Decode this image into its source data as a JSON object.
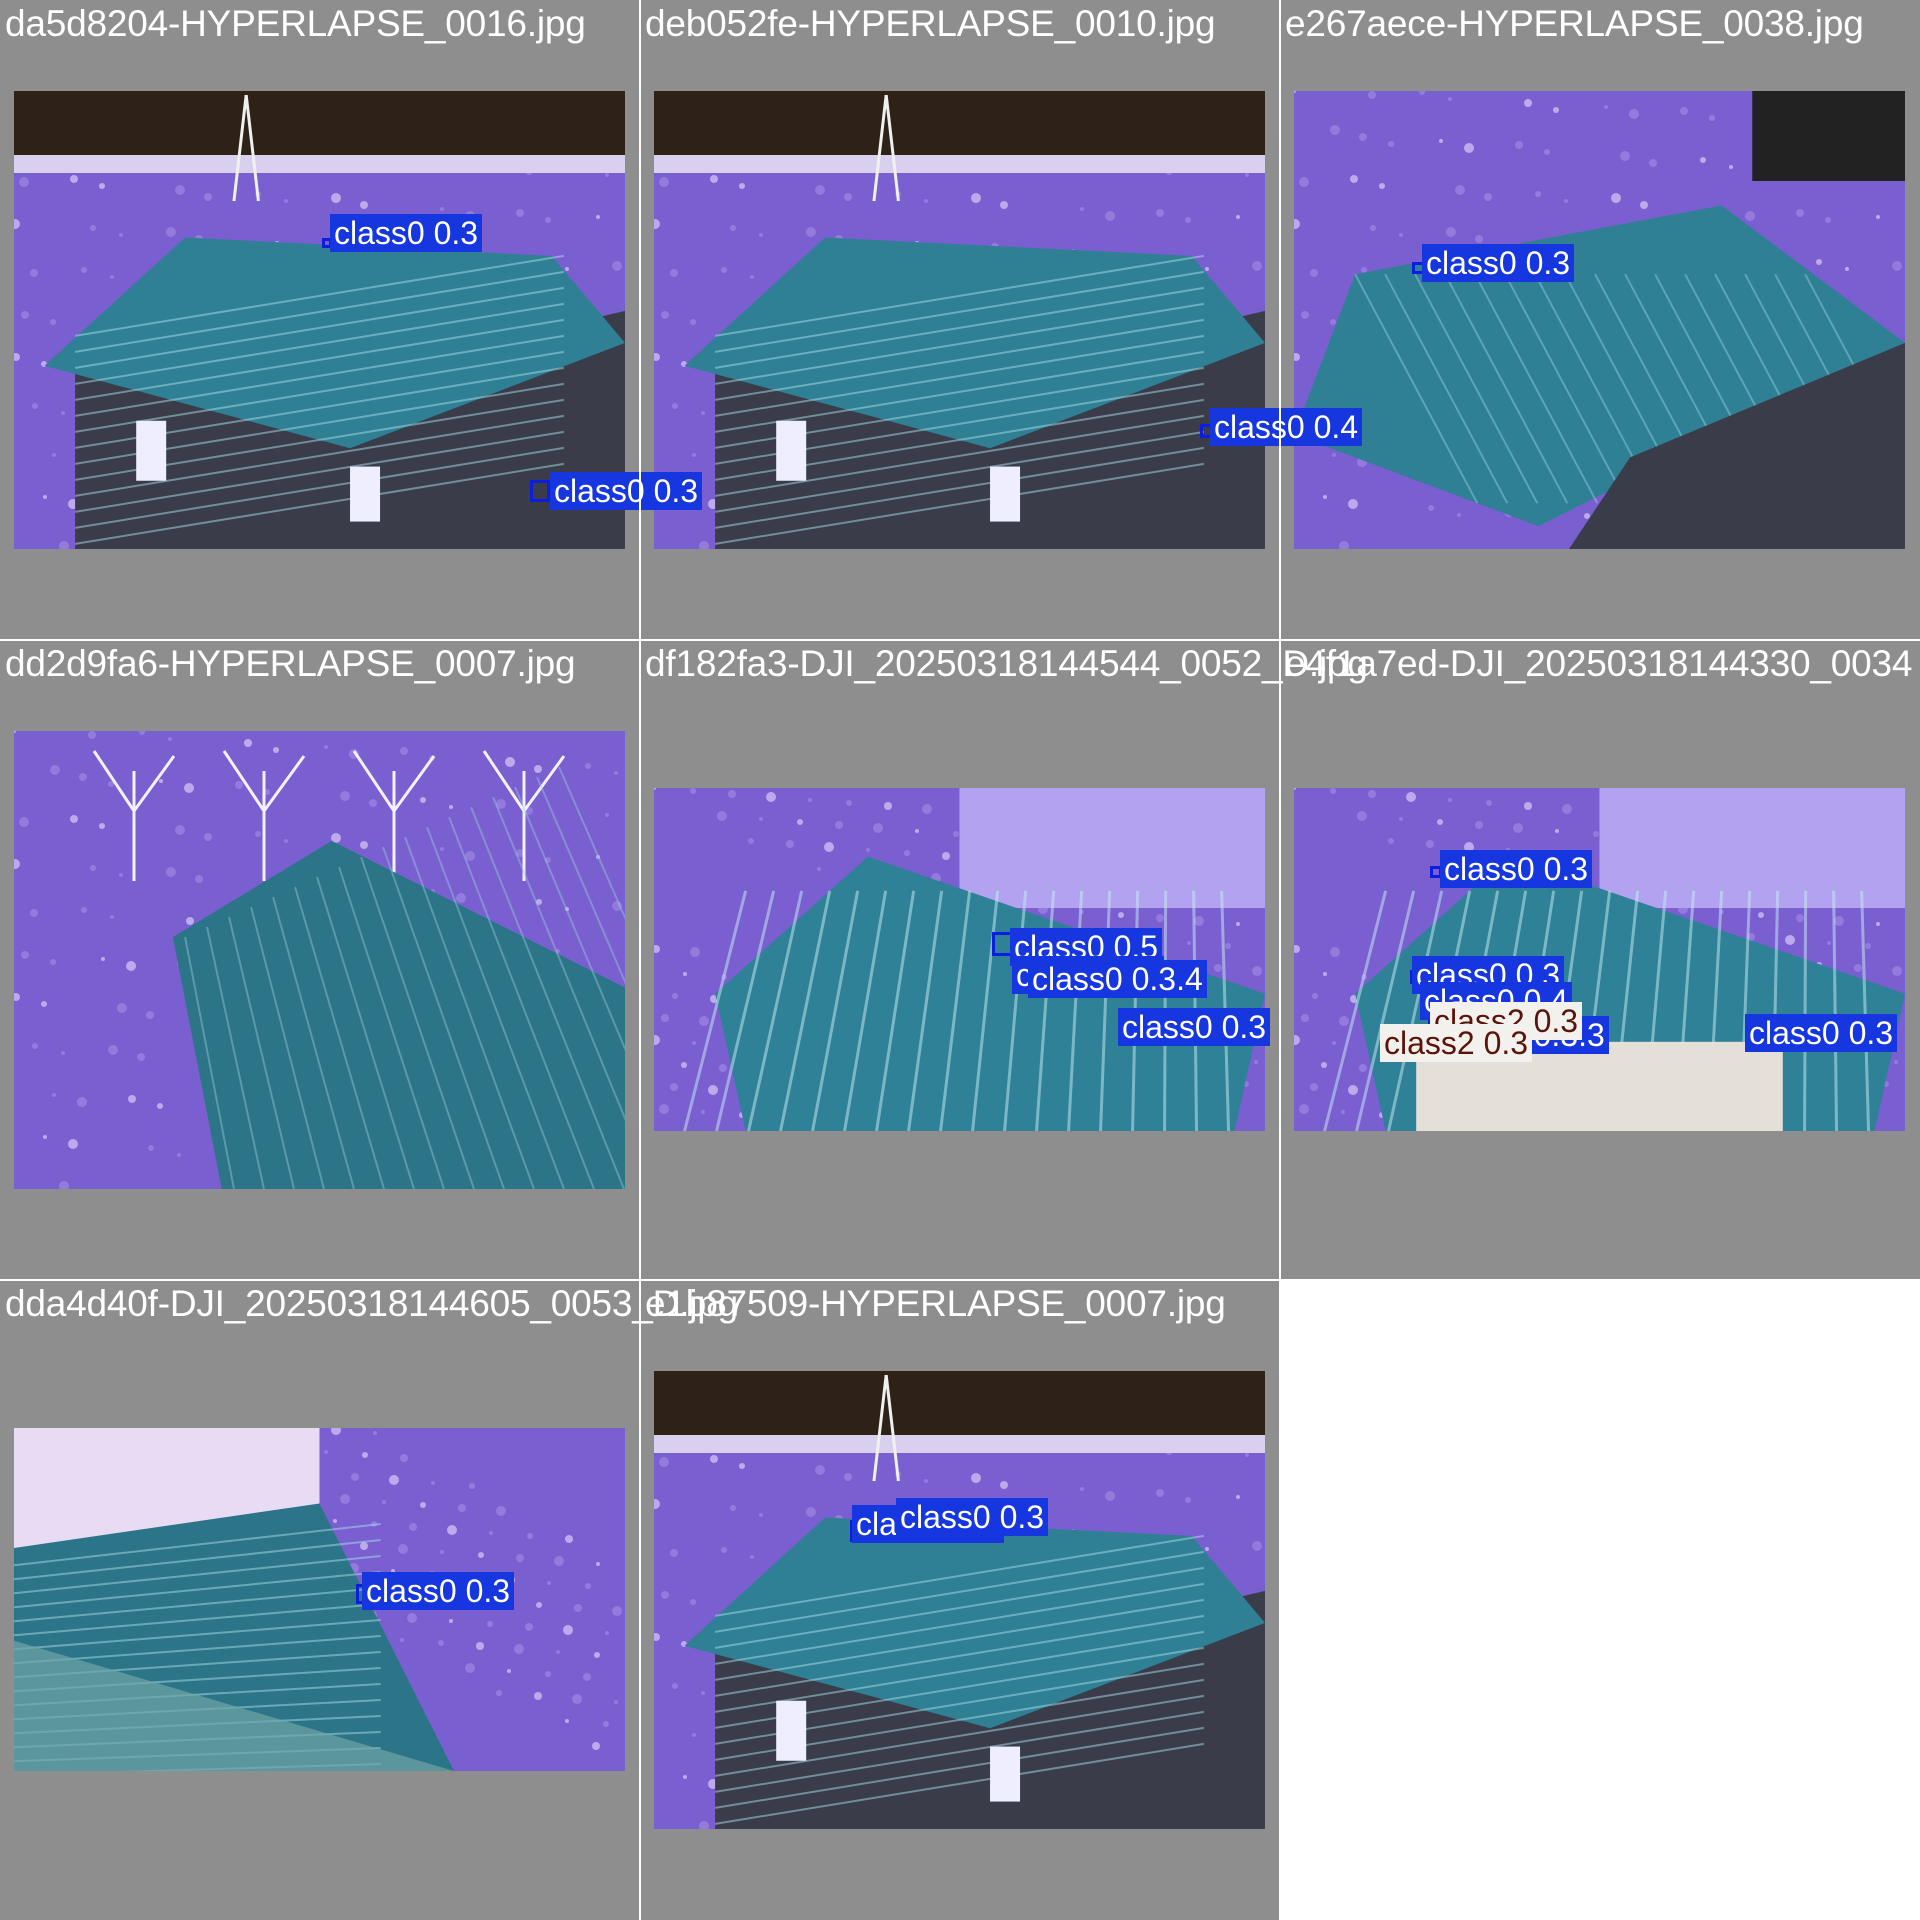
{
  "mosaic": {
    "background_color": "#8e8e8e",
    "cells": [
      {
        "title": "da5d8204-HYPERLAPSE_0016.jpg",
        "scene": "sky",
        "detections": [
          {
            "label": "class0 0.3",
            "cls": "class0"
          },
          {
            "label": "class0 0.3",
            "cls": "class0"
          }
        ]
      },
      {
        "title": "deb052fe-HYPERLAPSE_0010.jpg",
        "scene": "sky",
        "detections": [
          {
            "label": "class0 0.4",
            "cls": "class0"
          }
        ]
      },
      {
        "title": "e267aece-HYPERLAPSE_0038.jpg",
        "scene": "yard",
        "detections": [
          {
            "label": "class0 0.3",
            "cls": "class0"
          }
        ]
      },
      {
        "title": "dd2d9fa6-HYPERLAPSE_0007.jpg",
        "scene": "field",
        "detections": []
      },
      {
        "title": "df182fa3-DJI_20250318144544_0052_D.jpg",
        "scene": "closeup",
        "detections": [
          {
            "label": "class0 0.5",
            "cls": "class0"
          },
          {
            "label": "class0 0.4",
            "cls": "class0"
          },
          {
            "label": "class0 0.3.4",
            "cls": "class0"
          },
          {
            "label": "class0 0.3",
            "cls": "class0"
          }
        ]
      },
      {
        "title": "e4f1a7ed-DJI_20250318144330_0034",
        "scene": "closeup2",
        "detections": [
          {
            "label": "class0 0.3",
            "cls": "class0"
          },
          {
            "label": "class0 0.3",
            "cls": "class0"
          },
          {
            "label": "class0 0.4",
            "cls": "class0"
          },
          {
            "label": "class0 0.3.3",
            "cls": "class0"
          },
          {
            "label": "class2 0.3",
            "cls": "class2"
          },
          {
            "label": "class2 0.3",
            "cls": "class2"
          },
          {
            "label": "class0 0.3",
            "cls": "class0"
          }
        ]
      },
      {
        "title": "dda4d40f-DJI_20250318144605_0053_D.jpg",
        "scene": "topdown",
        "detections": [
          {
            "label": "class0 0.3",
            "cls": "class0"
          }
        ]
      },
      {
        "title": "e1b87509-HYPERLAPSE_0007.jpg",
        "scene": "sky",
        "detections": [
          {
            "label": "class0 0.3",
            "cls": "class0"
          },
          {
            "label": "class0 0.3",
            "cls": "class0"
          }
        ]
      }
    ]
  }
}
